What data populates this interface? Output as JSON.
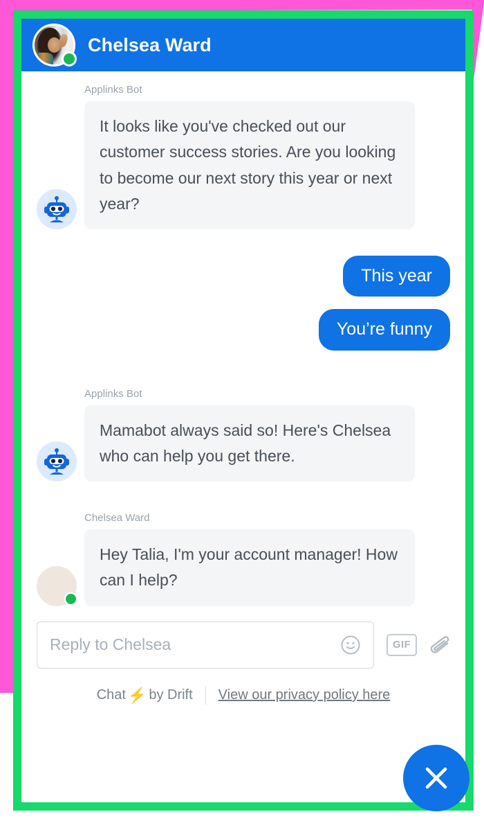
{
  "annotation": {
    "outer_border_color": "#ff57d8",
    "inner_border_color": "#18d96b"
  },
  "widget": {
    "header": {
      "title": "Chelsea Ward",
      "avatar_alt": "Chelsea Ward",
      "status": "online",
      "background_color": "#0f72e5"
    },
    "messages": [
      {
        "sender": "Applinks Bot",
        "avatar": "bot",
        "direction": "incoming",
        "text": "It looks like you've checked out our customer success stories. Are you looking to become our next story this year or next year?"
      },
      {
        "sender": "",
        "avatar": "none",
        "direction": "outgoing",
        "text": "This year"
      },
      {
        "sender": "",
        "avatar": "none",
        "direction": "outgoing",
        "text": "You’re funny"
      },
      {
        "sender": "Applinks Bot",
        "avatar": "bot",
        "direction": "incoming",
        "text": "Mamabot always said so! Here's Chelsea who can help you get there."
      },
      {
        "sender": "Chelsea Ward",
        "avatar": "photo",
        "direction": "incoming",
        "text": "Hey Talia, I'm your account manager! How can I help?"
      }
    ],
    "composer": {
      "placeholder": "Reply to Chelsea",
      "value": "",
      "emoji_icon": "smiley-icon",
      "gif_label": "GIF",
      "attachment_icon": "paperclip-icon"
    },
    "footer": {
      "brand_prefix": "Chat",
      "brand_bolt": "⚡",
      "brand_suffix": "by Drift",
      "privacy_link": "View our privacy policy here"
    },
    "close_button": {
      "icon": "close-icon",
      "color": "#0f72e5"
    }
  }
}
